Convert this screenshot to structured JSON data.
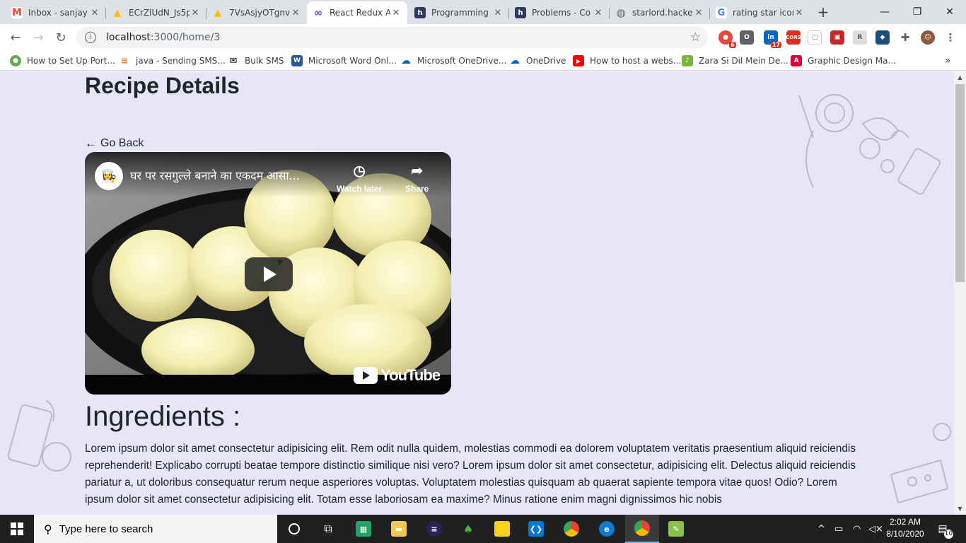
{
  "tabs": [
    {
      "title": "Inbox - sanjay",
      "icon": "gmail-icon",
      "color": "#ea4335",
      "letter": "M"
    },
    {
      "title": "ECrZlUdN_Js5p",
      "icon": "drive-icon",
      "color": "#fbbc04",
      "letter": "▲"
    },
    {
      "title": "7VsAsjyOTgnvl",
      "icon": "drive-icon",
      "color": "#fbbc04",
      "letter": "▲"
    },
    {
      "title": "React Redux A",
      "icon": "redux-icon",
      "color": "#764abc",
      "letter": "∞"
    },
    {
      "title": "Programming",
      "icon": "hackerrank-icon",
      "color": "#2e3b5e",
      "letter": "h"
    },
    {
      "title": "Problems - Co",
      "icon": "hackerrank-icon",
      "color": "#2e3b5e",
      "letter": "h"
    },
    {
      "title": "starlord.hacke",
      "icon": "globe-icon",
      "color": "#5f6368",
      "letter": "◍"
    },
    {
      "title": "rating star icor",
      "icon": "google-icon",
      "color": "#4285f4",
      "letter": "G"
    }
  ],
  "address": {
    "host": "localhost",
    "path": ":3000/home/3"
  },
  "bookmarks": [
    {
      "label": "How to Set Up Port...",
      "icon": "site-icon",
      "color": "#6aa84f",
      "letter": "●"
    },
    {
      "label": "java - Sending SMS...",
      "icon": "stackoverflow-icon",
      "color": "#f48024",
      "letter": "≡"
    },
    {
      "label": "Bulk SMS",
      "icon": "mail-icon",
      "color": "#000000",
      "letter": "✉"
    },
    {
      "label": "Microsoft Word Onl...",
      "icon": "word-icon",
      "color": "#2b579a",
      "letter": "W"
    },
    {
      "label": "Microsoft OneDrive...",
      "icon": "onedrive-icon",
      "color": "#0364b8",
      "letter": "☁"
    },
    {
      "label": "OneDrive",
      "icon": "onedrive-icon",
      "color": "#0364b8",
      "letter": "☁"
    },
    {
      "label": "How to host a webs...",
      "icon": "youtube-icon",
      "color": "#ff0000",
      "letter": "▶"
    },
    {
      "label": "Zara Si Dil Mein De...",
      "icon": "music-icon",
      "color": "#7cb342",
      "letter": "♪"
    },
    {
      "label": "Graphic Design Ma...",
      "icon": "angular-icon",
      "color": "#dd0031",
      "letter": "A"
    }
  ],
  "extensions": {
    "badge1": "6",
    "badge2": "17",
    "cors": "CORS"
  },
  "page": {
    "title": "Recipe Details",
    "go_back": "Go Back",
    "video": {
      "title": "घर पर रसगुल्ले बनाने का एकदम आसा...",
      "watch_later": "Watch later",
      "share": "Share",
      "brand": "YouTube"
    },
    "ingredients_heading": "Ingredients :",
    "ingredients_text": "Lorem ipsum dolor sit amet consectetur adipisicing elit. Rem odit nulla quidem, molestias commodi ea dolorem voluptatem veritatis praesentium aliquid reiciendis reprehenderit! Explicabo corrupti beatae tempore distinctio similique nisi vero? Lorem ipsum dolor sit amet consectetur, adipisicing elit. Delectus aliquid reiciendis pariatur a, ut doloribus consequatur rerum neque asperiores voluptas. Voluptatem molestias quisquam ab quaerat sapiente tempora vitae quos! Odio? Lorem ipsum dolor sit amet consectetur adipisicing elit. Totam esse laboriosam ea maxime? Minus ratione enim magni dignissimos hic nobis"
  },
  "taskbar": {
    "search_placeholder": "Type here to search",
    "time": "2:02 AM",
    "date": "8/10/2020",
    "notifications": "10"
  },
  "colors": {
    "page_bg": "#e6e6f8",
    "taskbar": "#202020",
    "tabstrip": "#dee1e6"
  }
}
